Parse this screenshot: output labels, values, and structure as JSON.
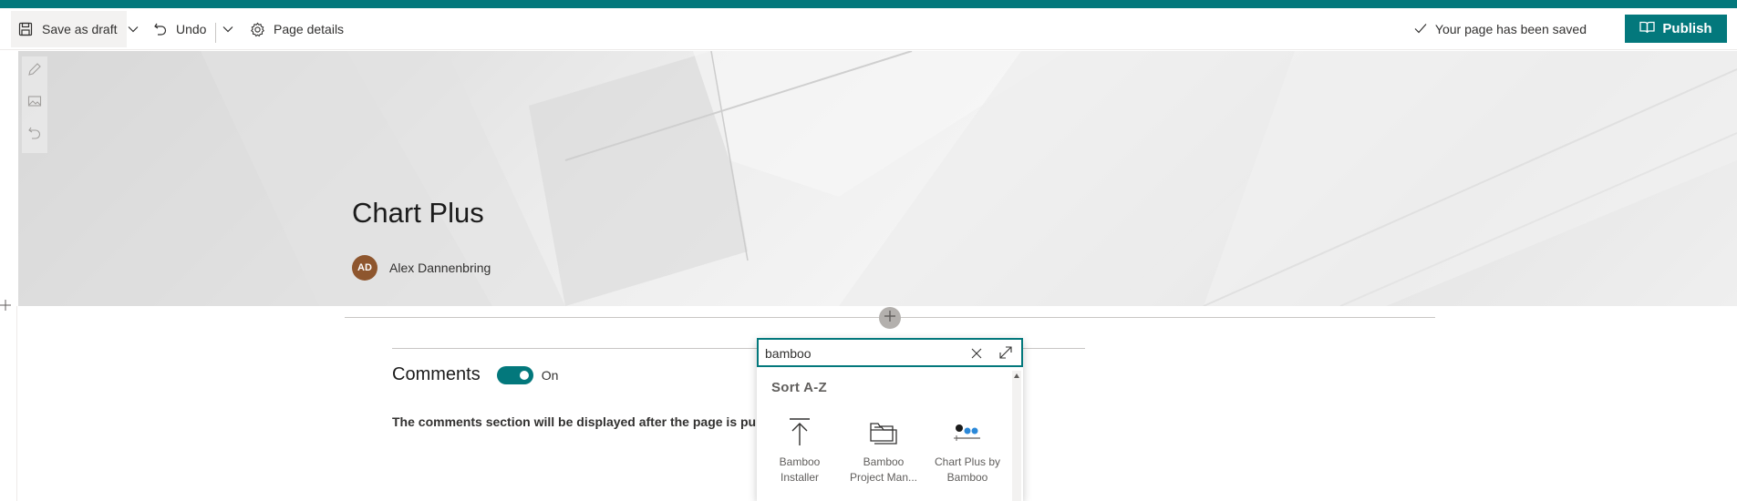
{
  "commandbar": {
    "save_draft": "Save as draft",
    "undo": "Undo",
    "page_details": "Page details",
    "saved_status": "Your page has been saved",
    "publish": "Publish"
  },
  "colors": {
    "accent": "#03787c",
    "avatar": "#8e562e"
  },
  "page": {
    "title": "Chart Plus",
    "author_initials": "AD",
    "author_name": "Alex Dannenbring"
  },
  "comments": {
    "heading": "Comments",
    "toggle_state": "On",
    "note": "The comments section will be displayed after the page is published"
  },
  "picker": {
    "search_value": "bamboo",
    "sort_label": "Sort A-Z",
    "items": [
      {
        "line1": "Bamboo",
        "line2": "Installer",
        "icon": "upload-icon"
      },
      {
        "line1": "Bamboo",
        "line2": "Project Man...",
        "icon": "folders-icon"
      },
      {
        "line1": "Chart Plus by",
        "line2": "Bamboo",
        "icon": "chart-plus-icon"
      }
    ]
  }
}
